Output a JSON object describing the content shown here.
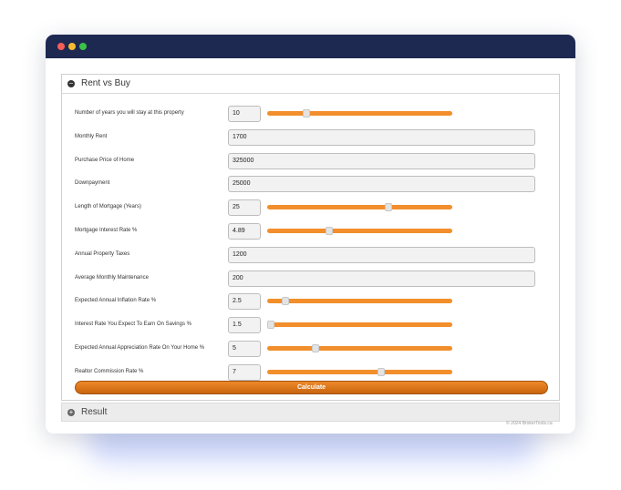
{
  "panel": {
    "title": "Rent vs Buy",
    "toggle_glyph": "−"
  },
  "fields": [
    {
      "label": "Number of years you will stay at this property",
      "value": "10",
      "slider_fraction": 0.2
    },
    {
      "label": "Monthly Rent",
      "value": "1700"
    },
    {
      "label": "Purchase Price of Home",
      "value": "325000"
    },
    {
      "label": "Downpayment",
      "value": "25000"
    },
    {
      "label": "Length of Mortgage (Years)",
      "value": "25",
      "slider_fraction": 0.66
    },
    {
      "label": "Mortgage Interest Rate %",
      "value": "4.89",
      "slider_fraction": 0.33
    },
    {
      "label": "Annual Property Taxes",
      "value": "1200"
    },
    {
      "label": "Average Monthly Maintenance",
      "value": "200"
    },
    {
      "label": "Expected Annual Inflation Rate %",
      "value": "2.5",
      "slider_fraction": 0.08
    },
    {
      "label": "Interest Rate You Expect To Earn On Savings %",
      "value": "1.5",
      "slider_fraction": 0.0
    },
    {
      "label": "Expected Annual Appreciation Rate On Your Home %",
      "value": "5",
      "slider_fraction": 0.25
    },
    {
      "label": "Realtor Commission Rate %",
      "value": "7",
      "slider_fraction": 0.62
    }
  ],
  "calculate_label": "Calculate",
  "result": {
    "title": "Result",
    "toggle_glyph": "+"
  },
  "footer": {
    "copyright": "© 2024 BrokerTools.ca"
  },
  "colors": {
    "titlebar": "#1e2952",
    "accent": "#f28e2b",
    "button": "#e07a1f"
  }
}
